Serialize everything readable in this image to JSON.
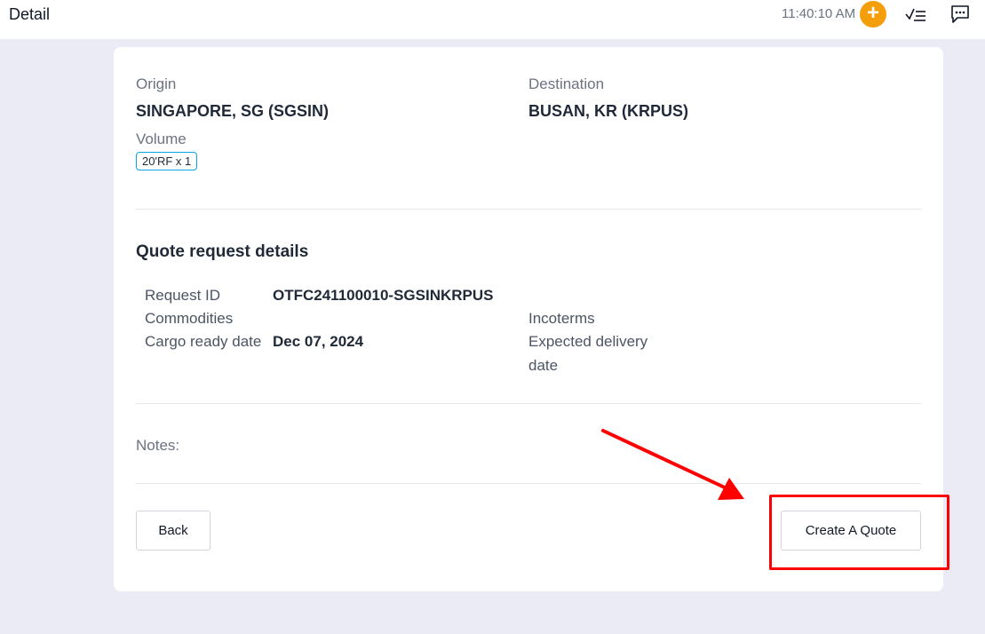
{
  "header": {
    "title": "Detail",
    "time": "11:40:10 AM",
    "add_symbol": "+",
    "icons": [
      "plus-icon",
      "checklist-icon",
      "chat-icon"
    ],
    "accent_color": "#f59e0b"
  },
  "route": {
    "origin_label": "Origin",
    "origin_value": "SINGAPORE, SG (SGSIN)",
    "destination_label": "Destination",
    "destination_value": "BUSAN, KR (KRPUS)",
    "volume_label": "Volume",
    "volume_tag": "20'RF x 1"
  },
  "details": {
    "title": "Quote request details",
    "request_id_label": "Request ID",
    "request_id_value": "OTFC241100010-SGSINKRPUS",
    "commodities_label": "Commodities",
    "incoterms_label": "Incoterms",
    "cargo_ready_label": "Cargo ready date",
    "cargo_ready_value": "Dec 07, 2024",
    "expected_delivery_label_line1": "Expected delivery",
    "expected_delivery_label_line2": "date"
  },
  "notes": {
    "label": "Notes:"
  },
  "actions": {
    "back_label": "Back",
    "create_quote_label": "Create A Quote"
  },
  "annotation": {
    "color": "#ff0000"
  }
}
